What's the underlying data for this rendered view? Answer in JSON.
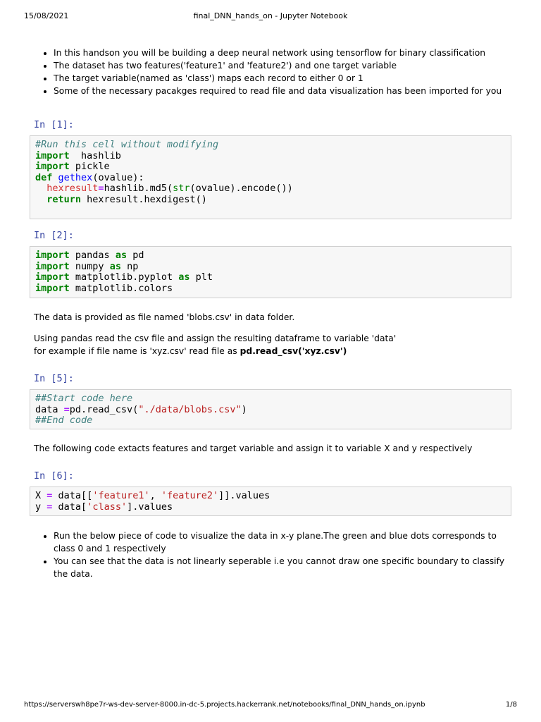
{
  "header": {
    "date": "15/08/2021",
    "title": "final_DNN_hands_on - Jupyter Notebook"
  },
  "footer": {
    "url": "https://serverswh8pe7r-ws-dev-server-8000.in-dc-5.projects.hackerrank.net/notebooks/final_DNN_hands_on.ipynb",
    "page": "1/8"
  },
  "intro_bullets": [
    "In this handson you will be building a deep neural network using tensorflow for binary classification",
    "The dataset has two features('feature1' and 'feature2') and one target variable",
    "The target variable(named as 'class') maps each record to either 0 or 1",
    "Some of the necessary pacakges required to read file and data visualization has been imported for you"
  ],
  "cells": [
    {
      "prompt": "In [1]:",
      "lines": [
        [
          [
            "cm",
            "#Run this cell without modifying"
          ]
        ],
        [
          [
            "kw",
            "import"
          ],
          [
            "",
            "  hashlib"
          ]
        ],
        [
          [
            "kw",
            "import"
          ],
          [
            "",
            " pickle"
          ]
        ],
        [
          [
            "kw",
            "def"
          ],
          [
            "",
            " "
          ],
          [
            "fn",
            "gethex"
          ],
          [
            "",
            "(ovalue):"
          ]
        ],
        [
          [
            "",
            "  "
          ],
          [
            "var",
            "hexresult"
          ],
          [
            "op",
            "="
          ],
          [
            "",
            "hashlib.md5("
          ],
          [
            "bi",
            "str"
          ],
          [
            "",
            "(ovalue).encode())"
          ]
        ],
        [
          [
            "",
            "  "
          ],
          [
            "kw",
            "return"
          ],
          [
            "",
            " hexresult.hexdigest()"
          ]
        ],
        [
          [
            "",
            ""
          ]
        ]
      ]
    },
    {
      "prompt": "In [2]:",
      "lines": [
        [
          [
            "kw",
            "import"
          ],
          [
            "",
            " pandas "
          ],
          [
            "kw",
            "as"
          ],
          [
            "",
            " pd"
          ]
        ],
        [
          [
            "kw",
            "import"
          ],
          [
            "",
            " numpy "
          ],
          [
            "kw",
            "as"
          ],
          [
            "",
            " np"
          ]
        ],
        [
          [
            "kw",
            "import"
          ],
          [
            "",
            " matplotlib.pyplot "
          ],
          [
            "kw",
            "as"
          ],
          [
            "",
            " plt"
          ]
        ],
        [
          [
            "kw",
            "import"
          ],
          [
            "",
            " matplotlib.colors"
          ]
        ]
      ]
    },
    {
      "prompt": "In [5]:",
      "lines": [
        [
          [
            "cm",
            "##Start code here"
          ]
        ],
        [
          [
            "",
            "data "
          ],
          [
            "op",
            "="
          ],
          [
            "",
            "pd.read_csv("
          ],
          [
            "st",
            "\"./data/blobs.csv\""
          ],
          [
            "",
            ")"
          ]
        ],
        [
          [
            "cm",
            "##End code"
          ]
        ]
      ]
    },
    {
      "prompt": "In [6]:",
      "lines": [
        [
          [
            "",
            "X "
          ],
          [
            "op",
            "="
          ],
          [
            "",
            " data[["
          ],
          [
            "st",
            "'feature1'"
          ],
          [
            "",
            ", "
          ],
          [
            "st",
            "'feature2'"
          ],
          [
            "",
            "]].values"
          ]
        ],
        [
          [
            "",
            "y "
          ],
          [
            "op",
            "="
          ],
          [
            "",
            " data["
          ],
          [
            "st",
            "'class'"
          ],
          [
            "",
            "].values"
          ]
        ]
      ]
    }
  ],
  "text": {
    "data_file": "The data is provided as file named 'blobs.csv' in data folder.",
    "read_line1": "Using pandas read the csv file and assign the resulting dataframe to variable 'data'",
    "read_line2": "for example if file name is 'xyz.csv' read file as ",
    "read_bold": "pd.read_csv('xyz.csv')",
    "extract": "The following code extacts features and target variable and assign it to variable X and y respectively"
  },
  "viz_bullets": [
    "Run the below piece of code to visualize the data in x-y plane.The green and blue dots corresponds to class 0 and 1 respectively",
    "You can see that the data is not linearly seperable i.e you cannot draw one specific boundary to classify the data."
  ]
}
